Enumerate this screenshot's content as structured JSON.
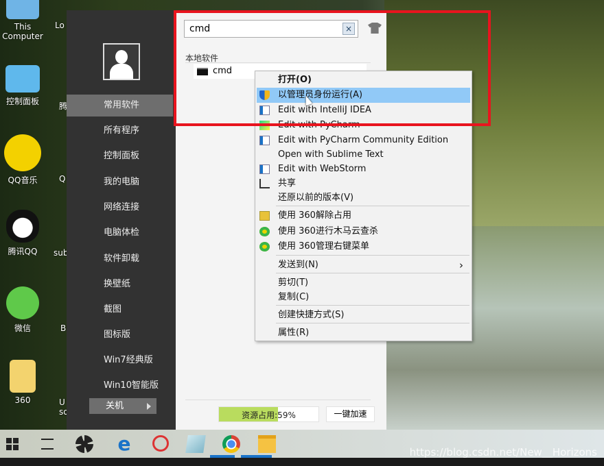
{
  "desktop": {
    "icons": [
      {
        "label": "This Computer"
      },
      {
        "label": "控制面板"
      },
      {
        "label": "QQ音乐"
      },
      {
        "label": "腾讯QQ"
      },
      {
        "label": "微信"
      },
      {
        "label": "360"
      }
    ],
    "partial_labels": [
      "Lo",
      "腾",
      "Q",
      "sub",
      "B",
      "U so"
    ]
  },
  "launcher": {
    "nav": [
      "常用软件",
      "所有程序",
      "控制面板",
      "我的电脑",
      "网络连接",
      "电脑体检",
      "软件卸载",
      "换壁纸",
      "截图",
      "图标版",
      "Win7经典版",
      "Win10智能版"
    ],
    "active": "常用软件",
    "power_label": "关机",
    "search": {
      "value": "cmd",
      "clear": "×"
    },
    "section_title": "本地软件",
    "results": [
      {
        "label": "cmd",
        "icon": "cmd-icon"
      }
    ],
    "usage": {
      "label": "资源占用:59%",
      "percent": 59,
      "color": "#b9dc5e"
    },
    "boost_label": "一键加速"
  },
  "context_menu": {
    "items": [
      {
        "label": "打开(O)",
        "bold": true
      },
      {
        "label": "以管理员身份运行(A)",
        "icon": "uac-shield-icon",
        "highlighted": true
      },
      {
        "label": "Edit with IntelliJ IDEA",
        "icon": "app-window-icon"
      },
      {
        "label": "Edit with PyCharm",
        "icon": "pycharm-icon"
      },
      {
        "label": "Edit with PyCharm Community Edition",
        "icon": "app-window-icon"
      },
      {
        "label": "Open with Sublime Text"
      },
      {
        "label": "Edit with WebStorm",
        "icon": "app-window-icon"
      },
      {
        "label": "共享",
        "icon": "share-icon"
      },
      {
        "label": "还原以前的版本(V)"
      },
      {
        "label": "使用 360解除占用",
        "icon": "360-unlock-icon"
      },
      {
        "label": "使用 360进行木马云查杀",
        "icon": "360-plus-icon"
      },
      {
        "label": "使用 360管理右键菜单",
        "icon": "360-plus-icon"
      },
      {
        "label": "发送到(N)",
        "submenu": true
      },
      {
        "label": "剪切(T)"
      },
      {
        "label": "复制(C)"
      },
      {
        "label": "创建快捷方式(S)"
      },
      {
        "label": "属性(R)"
      }
    ]
  },
  "annotation": {
    "color": "#e8141e"
  },
  "watermark": "https://blog.csdn.net/New__Horizons"
}
